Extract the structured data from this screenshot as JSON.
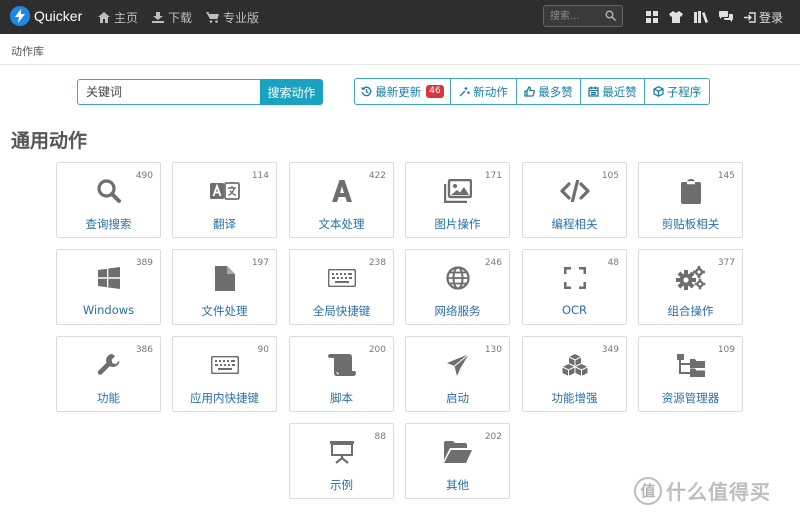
{
  "navbar": {
    "brand": "Quicker",
    "links": [
      {
        "label": "主页",
        "icon": "home-icon"
      },
      {
        "label": "下载",
        "icon": "download-icon"
      },
      {
        "label": "专业版",
        "icon": "cart-icon"
      }
    ],
    "search_placeholder": "搜索...",
    "right_icons": [
      "grid-icon",
      "tshirt-icon",
      "books-icon",
      "chat-icon"
    ],
    "login": "登录"
  },
  "breadcrumb": "动作库",
  "search": {
    "placeholder": "关键词",
    "button": "搜索动作"
  },
  "filters": [
    {
      "label": "最新更新",
      "icon": "history-icon",
      "badge": "46"
    },
    {
      "label": "新动作",
      "icon": "sparkle-icon"
    },
    {
      "label": "最多赞",
      "icon": "thumbs-up-icon"
    },
    {
      "label": "最近赞",
      "icon": "calendar-icon"
    },
    {
      "label": "子程序",
      "icon": "cube-icon"
    }
  ],
  "section_title": "通用动作",
  "categories": [
    {
      "label": "查询搜索",
      "count": "490",
      "icon": "search-icon"
    },
    {
      "label": "翻译",
      "count": "114",
      "icon": "translate-icon"
    },
    {
      "label": "文本处理",
      "count": "422",
      "icon": "text-icon"
    },
    {
      "label": "图片操作",
      "count": "171",
      "icon": "image-icon"
    },
    {
      "label": "编程相关",
      "count": "105",
      "icon": "code-icon"
    },
    {
      "label": "剪贴板相关",
      "count": "145",
      "icon": "clipboard-icon"
    },
    {
      "label": "Windows",
      "count": "389",
      "icon": "windows-icon"
    },
    {
      "label": "文件处理",
      "count": "197",
      "icon": "file-icon"
    },
    {
      "label": "全局快捷键",
      "count": "238",
      "icon": "keyboard-icon"
    },
    {
      "label": "网络服务",
      "count": "246",
      "icon": "globe-icon"
    },
    {
      "label": "OCR",
      "count": "48",
      "icon": "scan-icon"
    },
    {
      "label": "组合操作",
      "count": "377",
      "icon": "cogs-icon"
    },
    {
      "label": "功能",
      "count": "386",
      "icon": "wrench-icon"
    },
    {
      "label": "应用内快捷键",
      "count": "90",
      "icon": "keyboard-icon"
    },
    {
      "label": "脚本",
      "count": "200",
      "icon": "scroll-icon"
    },
    {
      "label": "启动",
      "count": "130",
      "icon": "paper-plane-icon"
    },
    {
      "label": "功能增强",
      "count": "349",
      "icon": "cubes-icon"
    },
    {
      "label": "资源管理器",
      "count": "109",
      "icon": "folder-tree-icon"
    },
    {
      "label": "示例",
      "count": "88",
      "icon": "presentation-icon"
    },
    {
      "label": "其他",
      "count": "202",
      "icon": "folder-open-icon"
    }
  ],
  "watermark": {
    "logo": "值",
    "text": "什么值得买"
  }
}
